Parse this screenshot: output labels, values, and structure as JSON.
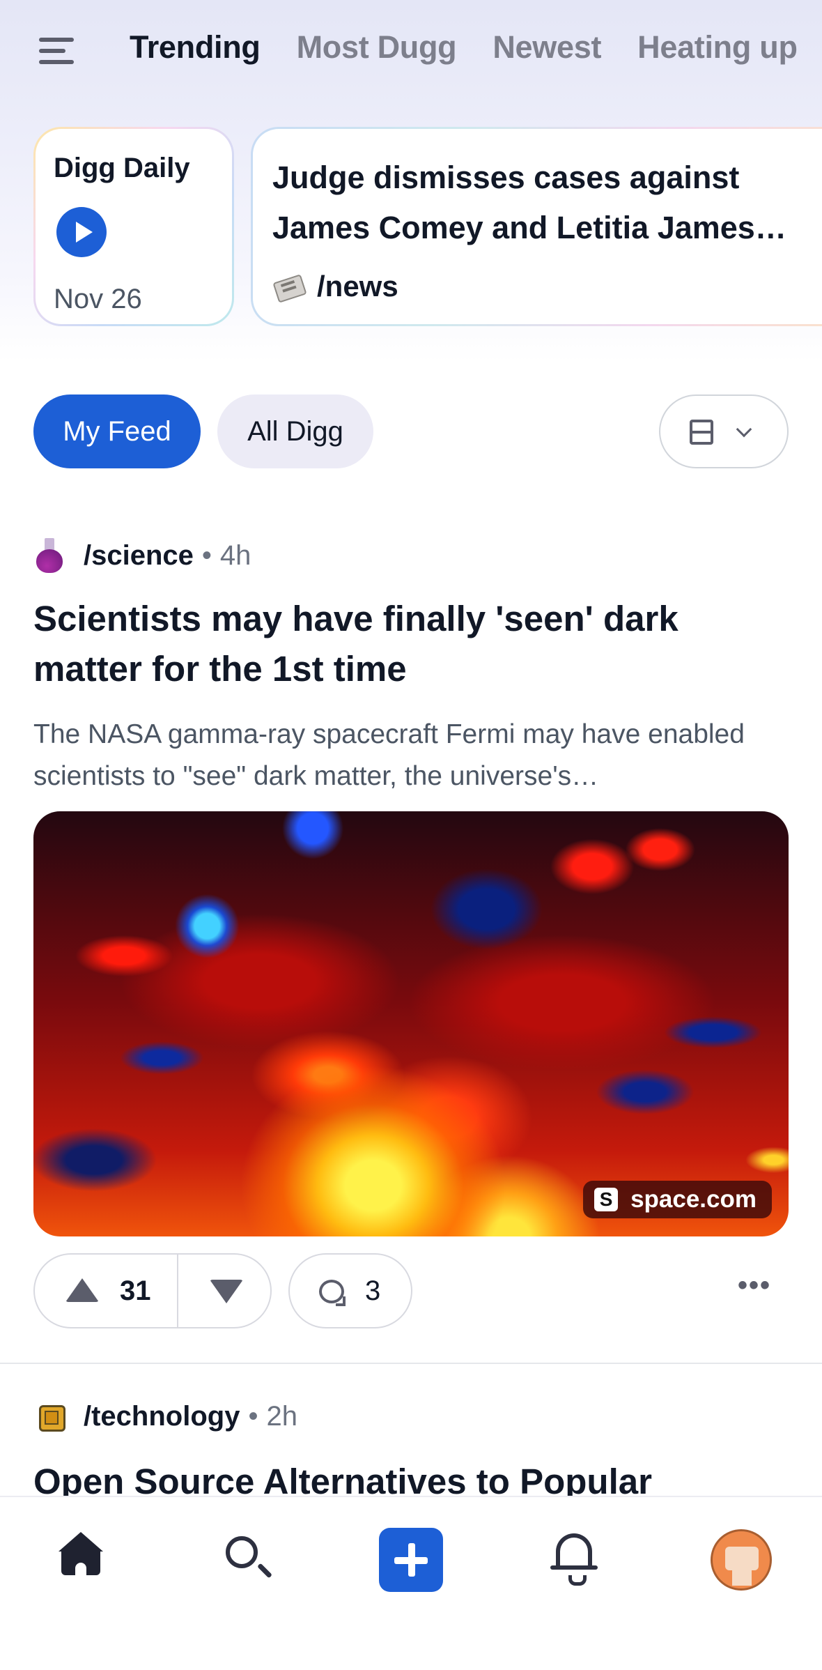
{
  "header": {
    "menu_icon": "hamburger-menu-icon",
    "tabs": [
      {
        "label": "Trending",
        "active": true
      },
      {
        "label": "Most Dugg",
        "active": false
      },
      {
        "label": "Newest",
        "active": false
      },
      {
        "label": "Heating up",
        "active": false
      }
    ]
  },
  "top_cards": {
    "daily": {
      "title": "Digg Daily",
      "date": "Nov 26",
      "icon": "play-icon"
    },
    "featured": {
      "title": "Judge dismisses cases against James Comey and Letitia James…",
      "community": "/news",
      "icon": "newspaper-icon"
    }
  },
  "feed_toggle": {
    "my_feed": "My Feed",
    "all_digg": "All Digg",
    "active": "My Feed",
    "layout_icon": "layout-icon"
  },
  "posts": [
    {
      "community": "/science",
      "community_icon": "flask-icon",
      "separator": "•",
      "age": "4h",
      "title": "Scientists may have finally 'seen' dark matter for the 1st time",
      "description": "The NASA gamma-ray spacecraft Fermi may have enabled scientists to \"see\" dark matter, the universe's…",
      "source": "space.com",
      "source_icon_letter": "S",
      "votes": "31",
      "comments": "3"
    },
    {
      "community": "/technology",
      "community_icon": "microchip-icon",
      "separator": "•",
      "age": "2h",
      "title": "Open Source Alternatives to Popular"
    }
  ],
  "bottom_nav": [
    {
      "name": "home",
      "icon": "home-icon",
      "active": true
    },
    {
      "name": "search",
      "icon": "search-icon"
    },
    {
      "name": "add",
      "icon": "plus-icon"
    },
    {
      "name": "notifications",
      "icon": "bell-icon"
    },
    {
      "name": "profile",
      "icon": "avatar"
    }
  ],
  "colors": {
    "accent": "#1d5fd6",
    "text": "#111827",
    "muted": "#6b7280"
  }
}
